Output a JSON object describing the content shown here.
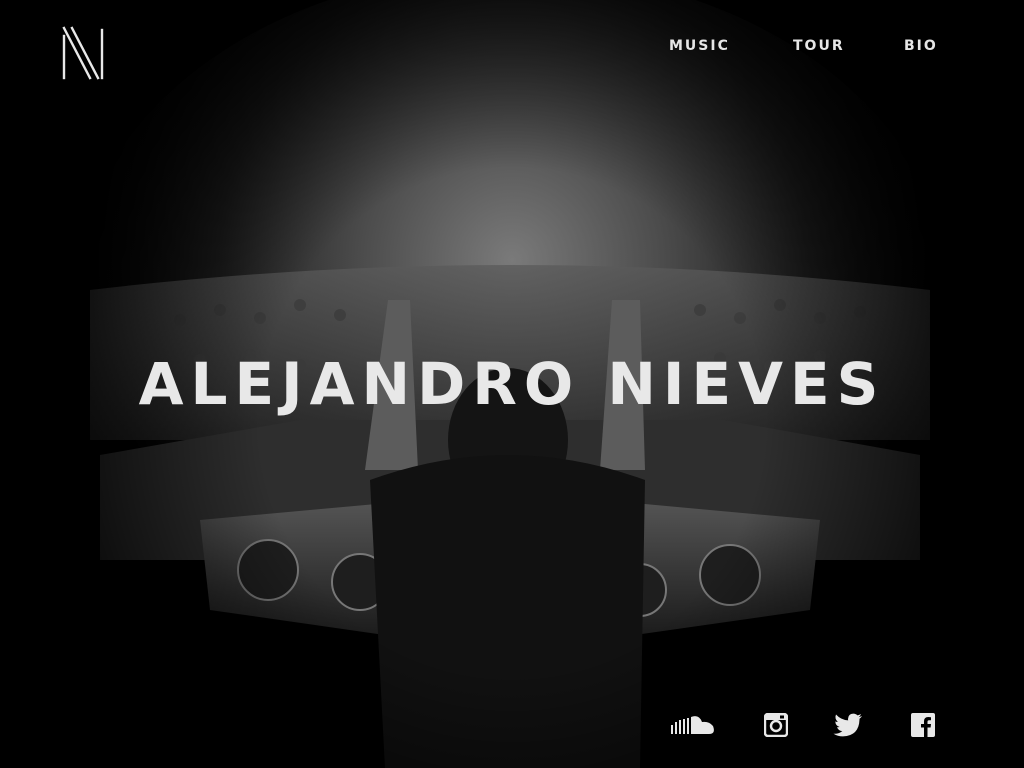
{
  "brand": {
    "logo_icon": "n-monogram-logo-icon"
  },
  "nav": {
    "items": [
      {
        "label": "MUSIC"
      },
      {
        "label": "TOUR"
      },
      {
        "label": "BIO"
      }
    ]
  },
  "hero": {
    "title": "ALEJANDRO NIEVES",
    "background_image": "grayscale-concert-dj-photo"
  },
  "social": {
    "icons": [
      "soundcloud-icon",
      "instagram-icon",
      "twitter-icon",
      "facebook-icon"
    ]
  },
  "colors": {
    "background": "#000000",
    "text": "#e8e8e8"
  }
}
